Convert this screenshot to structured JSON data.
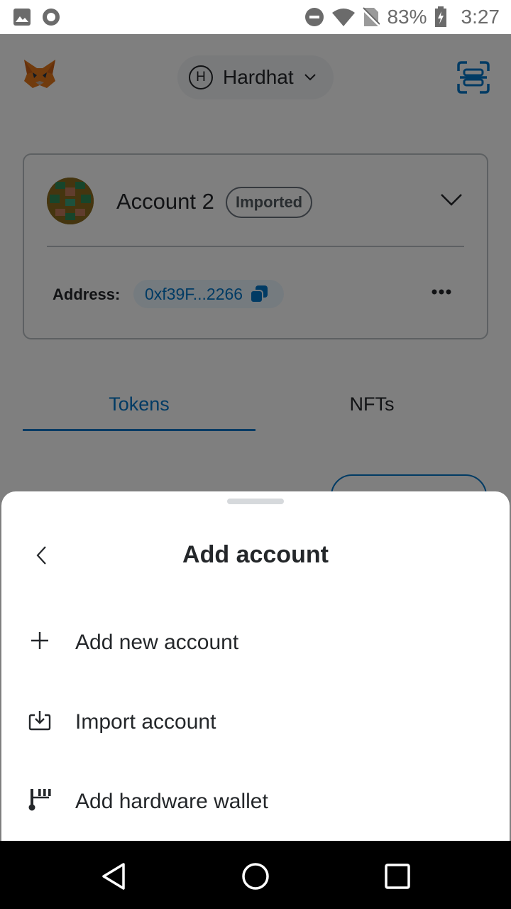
{
  "status_bar": {
    "icons_left": [
      "image-icon",
      "record-icon"
    ],
    "icons_right": [
      "dnd-icon",
      "wifi-icon",
      "no-sim-icon"
    ],
    "battery": "83%",
    "time": "3:27"
  },
  "header": {
    "network": {
      "badge": "H",
      "name": "Hardhat"
    }
  },
  "account_card": {
    "name": "Account 2",
    "badge": "Imported",
    "address_label": "Address:",
    "address": "0xf39F...2266"
  },
  "tabs": [
    {
      "label": "Tokens",
      "active": true
    },
    {
      "label": "NFTs",
      "active": false
    }
  ],
  "sheet": {
    "title": "Add account",
    "items": [
      {
        "label": "Add new account",
        "icon": "plus-icon"
      },
      {
        "label": "Import account",
        "icon": "import-icon"
      },
      {
        "label": "Add hardware wallet",
        "icon": "hardware-wallet-icon"
      }
    ]
  },
  "colors": {
    "accent": "#0376c9",
    "text": "#24272a",
    "border": "#bbc0c5",
    "overlay": "rgba(0,0,0,0.5)"
  }
}
